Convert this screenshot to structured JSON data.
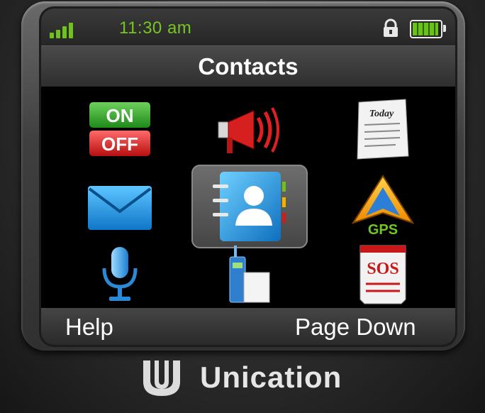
{
  "status_bar": {
    "time": "11:30 am",
    "signal_icon": "signal-bars-icon",
    "lock_icon": "lock-icon",
    "battery_icon": "battery-full-icon",
    "accent_color": "#6fc21b"
  },
  "screen": {
    "title": "Contacts"
  },
  "menu_icons": [
    {
      "name": "on-off-icon",
      "labels": [
        "ON",
        "OFF"
      ]
    },
    {
      "name": "megaphone-icon"
    },
    {
      "name": "calendar-today-icon",
      "label": "Today"
    },
    {
      "name": "mail-envelope-icon"
    },
    {
      "name": "contacts-icon",
      "selected": true
    },
    {
      "name": "gps-icon",
      "label": "GPS"
    },
    {
      "name": "microphone-icon"
    },
    {
      "name": "radio-icon"
    },
    {
      "name": "sos-icon",
      "label": "SOS"
    }
  ],
  "softkeys": {
    "left": "Help",
    "right": "Page Down"
  },
  "brand": {
    "name": "Unication"
  }
}
